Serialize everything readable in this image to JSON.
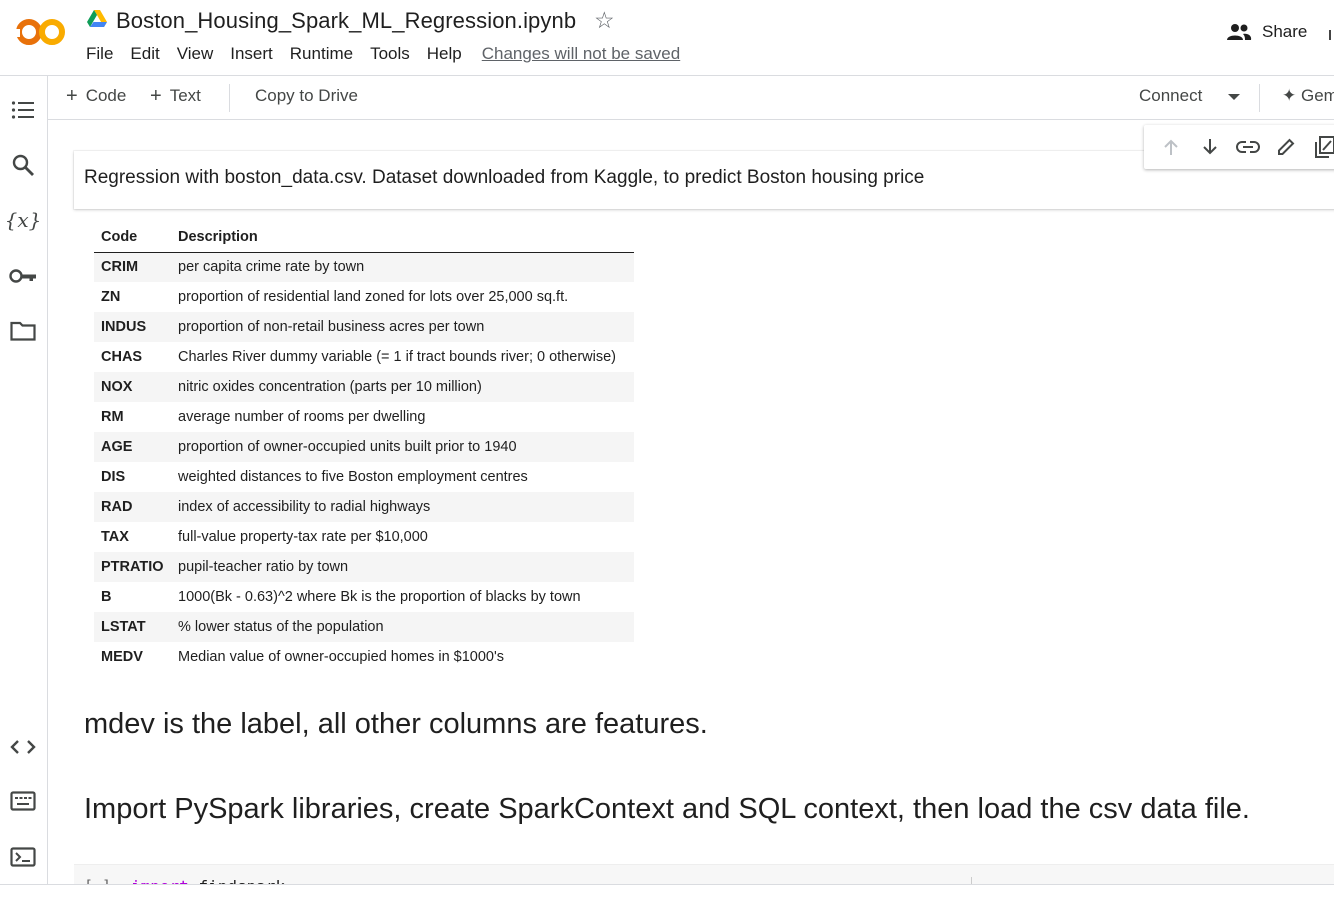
{
  "header": {
    "logo_text": "CO",
    "notebook_title": "Boston_Housing_Spark_ML_Regression.ipynb",
    "menu": [
      "File",
      "Edit",
      "View",
      "Insert",
      "Runtime",
      "Tools",
      "Help"
    ],
    "unsaved_notice": "Changes will not be saved",
    "share_label": "Share",
    "colors": {
      "logo_orange": "#F9AB00",
      "logo_dark_orange": "#E8710A"
    }
  },
  "toolbar": {
    "add_code_label": "Code",
    "add_text_label": "Text",
    "copy_to_drive_label": "Copy to Drive",
    "connect_label": "Connect",
    "gemini_label": "Gemini"
  },
  "sidebar": {
    "items": [
      {
        "name": "table-of-contents-icon"
      },
      {
        "name": "search-icon"
      },
      {
        "name": "variables-icon",
        "glyph": "{x}"
      },
      {
        "name": "secrets-key-icon"
      },
      {
        "name": "files-folder-icon"
      },
      {
        "name": "code-snippets-icon"
      },
      {
        "name": "command-palette-icon"
      },
      {
        "name": "terminal-icon"
      }
    ]
  },
  "cell_toolbar": {
    "items": [
      "move-up",
      "move-down",
      "copy-link",
      "edit",
      "mirror-cell"
    ]
  },
  "notebook": {
    "intro_text": "Regression with boston_data.csv. Dataset downloaded from Kaggle, to predict Boston housing price",
    "table": {
      "headers": [
        "Code",
        "Description"
      ],
      "rows": [
        [
          "CRIM",
          "per capita crime rate by town"
        ],
        [
          "ZN",
          "proportion of residential land zoned for lots over 25,000 sq.ft."
        ],
        [
          "INDUS",
          "proportion of non-retail business acres per town"
        ],
        [
          "CHAS",
          "Charles River dummy variable (= 1 if tract bounds river; 0 otherwise)"
        ],
        [
          "NOX",
          "nitric oxides concentration (parts per 10 million)"
        ],
        [
          "RM",
          "average number of rooms per dwelling"
        ],
        [
          "AGE",
          "proportion of owner-occupied units built prior to 1940"
        ],
        [
          "DIS",
          "weighted distances to five Boston employment centres"
        ],
        [
          "RAD",
          "index of accessibility to radial highways"
        ],
        [
          "TAX",
          "full-value property-tax rate per $10,000"
        ],
        [
          "PTRATIO",
          "pupil-teacher ratio by town"
        ],
        [
          "B",
          "1000(Bk - 0.63)^2 where Bk is the proportion of blacks by town"
        ],
        [
          "LSTAT",
          "% lower status of the population"
        ],
        [
          "MEDV",
          "Median value of owner-occupied homes in $1000's"
        ]
      ]
    },
    "heading_label": "mdev is the label, all other columns are features.",
    "heading_import": "Import PySpark libraries, create SparkContext and SQL context, then load the csv data file.",
    "code_cell": {
      "exec_bracket": "[ ]",
      "keyword": "import",
      "module": "findspark"
    }
  }
}
